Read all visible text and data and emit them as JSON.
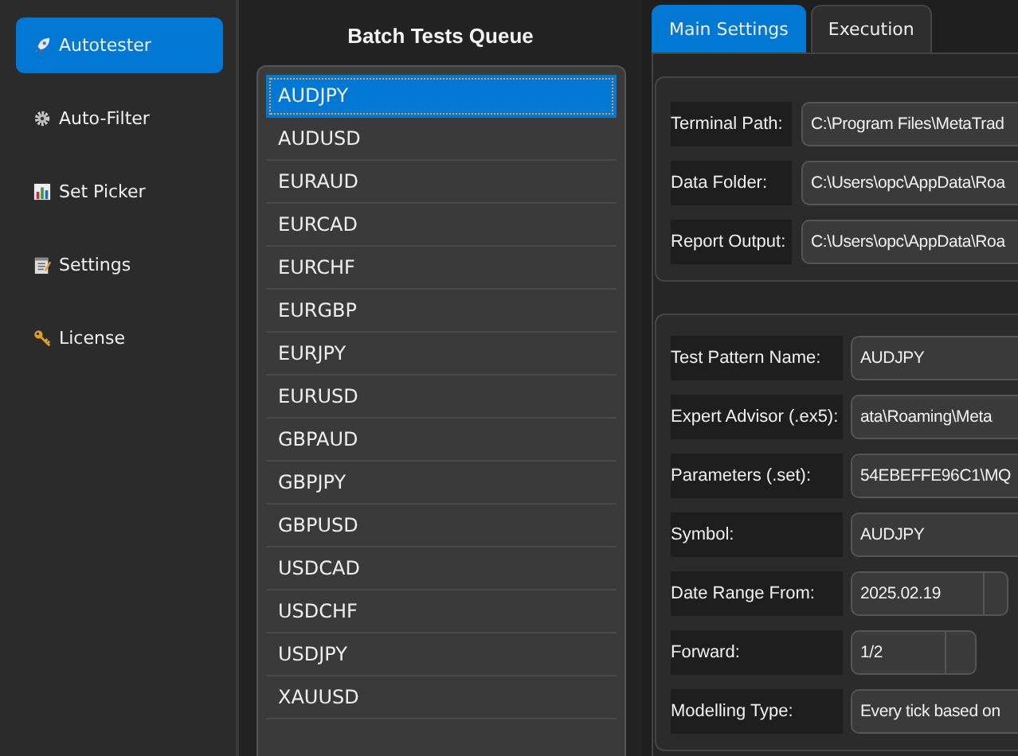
{
  "sidebar": {
    "items": [
      {
        "label": "Autotester",
        "selected": true
      },
      {
        "label": "Auto-Filter",
        "selected": false
      },
      {
        "label": "Set Picker",
        "selected": false
      },
      {
        "label": "Settings",
        "selected": false
      },
      {
        "label": "License",
        "selected": false
      }
    ]
  },
  "queue": {
    "title": "Batch Tests Queue",
    "items": [
      {
        "label": "AUDJPY",
        "selected": true
      },
      {
        "label": "AUDUSD",
        "selected": false
      },
      {
        "label": "EURAUD",
        "selected": false
      },
      {
        "label": "EURCAD",
        "selected": false
      },
      {
        "label": "EURCHF",
        "selected": false
      },
      {
        "label": "EURGBP",
        "selected": false
      },
      {
        "label": "EURJPY",
        "selected": false
      },
      {
        "label": "EURUSD",
        "selected": false
      },
      {
        "label": "GBPAUD",
        "selected": false
      },
      {
        "label": "GBPJPY",
        "selected": false
      },
      {
        "label": "GBPUSD",
        "selected": false
      },
      {
        "label": "USDCAD",
        "selected": false
      },
      {
        "label": "USDCHF",
        "selected": false
      },
      {
        "label": "USDJPY",
        "selected": false
      },
      {
        "label": "XAUUSD",
        "selected": false
      }
    ]
  },
  "tabs": [
    {
      "label": "Main Settings",
      "selected": true
    },
    {
      "label": "Execution",
      "selected": false
    }
  ],
  "paths": [
    {
      "label": "Terminal Path:",
      "value": "C:\\Program Files\\MetaTrad"
    },
    {
      "label": "Data Folder:",
      "value": "C:\\Users\\opc\\AppData\\Roa"
    },
    {
      "label": "Report Output:",
      "value": "C:\\Users\\opc\\AppData\\Roa"
    }
  ],
  "test": [
    {
      "label": "Test Pattern Name:",
      "kind": "text",
      "value": "AUDJPY"
    },
    {
      "label": "Expert Advisor (.ex5):",
      "kind": "text",
      "value": "ata\\Roaming\\Meta"
    },
    {
      "label": "Parameters (.set):",
      "kind": "text",
      "value": "54EBEFFE96C1\\MQ"
    },
    {
      "label": "Symbol:",
      "kind": "text",
      "value": "AUDJPY"
    },
    {
      "label": "Date Range From:",
      "kind": "date",
      "value": "2025.02.19"
    },
    {
      "label": "Forward:",
      "kind": "spin",
      "value": "1/2"
    },
    {
      "label": "Modelling Type:",
      "kind": "text",
      "value": "Every tick based on"
    }
  ]
}
